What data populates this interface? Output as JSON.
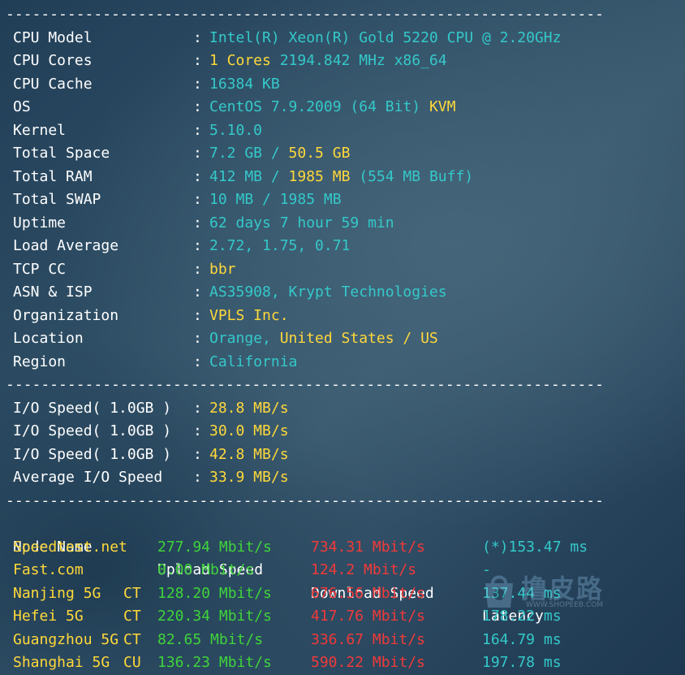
{
  "separator": "----------------------------------------------------------------------",
  "sysinfo": [
    {
      "label": "CPU Model",
      "parts": [
        {
          "t": "Intel(R) Xeon(R) Gold 5220 CPU @ 2.20GHz",
          "c": "cyan"
        }
      ]
    },
    {
      "label": "CPU Cores",
      "parts": [
        {
          "t": "1 Cores",
          "c": "yellow"
        },
        {
          "t": " 2194.842 MHz x86_64",
          "c": "cyan"
        }
      ]
    },
    {
      "label": "CPU Cache",
      "parts": [
        {
          "t": "16384 KB",
          "c": "cyan"
        }
      ]
    },
    {
      "label": "OS",
      "parts": [
        {
          "t": "CentOS 7.9.2009 (64 Bit) ",
          "c": "cyan"
        },
        {
          "t": "KVM",
          "c": "yellow"
        }
      ]
    },
    {
      "label": "Kernel",
      "parts": [
        {
          "t": "5.10.0",
          "c": "cyan"
        }
      ]
    },
    {
      "label": "Total Space",
      "parts": [
        {
          "t": "7.2 GB / ",
          "c": "cyan"
        },
        {
          "t": "50.5 GB",
          "c": "yellow"
        }
      ]
    },
    {
      "label": "Total RAM",
      "parts": [
        {
          "t": "412 MB / ",
          "c": "cyan"
        },
        {
          "t": "1985 MB",
          "c": "yellow"
        },
        {
          "t": " (554 MB Buff)",
          "c": "cyan"
        }
      ]
    },
    {
      "label": "Total SWAP",
      "parts": [
        {
          "t": "10 MB / 1985 MB",
          "c": "cyan"
        }
      ]
    },
    {
      "label": "Uptime",
      "parts": [
        {
          "t": "62 days 7 hour 59 min",
          "c": "cyan"
        }
      ]
    },
    {
      "label": "Load Average",
      "parts": [
        {
          "t": "2.72, 1.75, 0.71",
          "c": "cyan"
        }
      ]
    },
    {
      "label": "TCP CC",
      "parts": [
        {
          "t": "bbr",
          "c": "yellow"
        }
      ]
    },
    {
      "label": "ASN & ISP",
      "parts": [
        {
          "t": "AS35908, Krypt Technologies",
          "c": "cyan"
        }
      ]
    },
    {
      "label": "Organization",
      "parts": [
        {
          "t": "VPLS Inc.",
          "c": "yellow"
        }
      ]
    },
    {
      "label": "Location",
      "parts": [
        {
          "t": "Orange, ",
          "c": "cyan"
        },
        {
          "t": "United States / US",
          "c": "yellow"
        }
      ]
    },
    {
      "label": "Region",
      "parts": [
        {
          "t": "California",
          "c": "cyan"
        }
      ]
    }
  ],
  "io": [
    {
      "label": "I/O Speed( 1.0GB )",
      "value": "28.8 MB/s"
    },
    {
      "label": "I/O Speed( 1.0GB )",
      "value": "30.0 MB/s"
    },
    {
      "label": "I/O Speed( 1.0GB )",
      "value": "42.8 MB/s"
    },
    {
      "label": "Average I/O Speed",
      "value": "33.9 MB/s"
    }
  ],
  "speed": {
    "headers": {
      "node": "Node Name",
      "upload": "Upload Speed",
      "download": "Download Speed",
      "latency": "Latency"
    },
    "rows": [
      {
        "node": "Speedtest.net",
        "isp": "",
        "upload": "277.94 Mbit/s",
        "download": "734.31 Mbit/s",
        "latency": "(*)153.47 ms"
      },
      {
        "node": "Fast.com",
        "isp": "",
        "upload": "0.00 Mbit/s",
        "download": "124.2 Mbit/s",
        "latency": "-"
      },
      {
        "node": "Nanjing 5G",
        "isp": "CT",
        "upload": "128.20 Mbit/s",
        "download": "676.56 Mbit/s",
        "latency": "137.44 ms"
      },
      {
        "node": "Hefei 5G",
        "isp": "CT",
        "upload": "220.34 Mbit/s",
        "download": "417.76 Mbit/s",
        "latency": "178.22 ms"
      },
      {
        "node": "Guangzhou 5G",
        "isp": "CT",
        "upload": "82.65 Mbit/s",
        "download": "336.67 Mbit/s",
        "latency": "164.79 ms"
      },
      {
        "node": "Shanghai 5G",
        "isp": "CU",
        "upload": "136.23 Mbit/s",
        "download": "590.22 Mbit/s",
        "latency": "197.78 ms"
      }
    ]
  },
  "watermark": {
    "text": "撸皮路",
    "url": "WWW.SHOPEEB.COM"
  },
  "colors": {
    "cyan": "#34c9c9",
    "yellow": "#ffd83a",
    "green": "#3fd43a",
    "red": "#f03a3a",
    "white": "#ffffff"
  }
}
